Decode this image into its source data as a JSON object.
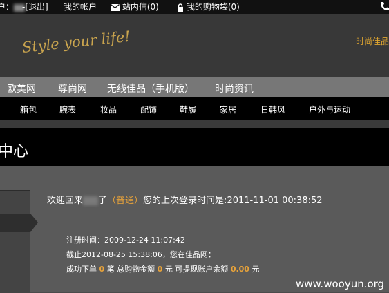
{
  "topbar": {
    "user_fragment": "户：",
    "logout": "-[退出]",
    "account": "我的帐户",
    "messages": "站内信(0)",
    "cart": "我的购物袋(0)"
  },
  "header": {
    "slogan": "Style your life!",
    "right_link": "时尚佳品"
  },
  "main_nav": [
    "欧美网",
    "尊尚网",
    "无线佳品（手机版）",
    "时尚资讯"
  ],
  "category_nav": [
    "箱包",
    "腕表",
    "妆品",
    "配饰",
    "鞋履",
    "家居",
    "日韩风",
    "户外与运动"
  ],
  "page_title": "中心",
  "welcome": {
    "prefix": "欢迎回来",
    "name_suffix": "子",
    "level": "（普通）",
    "last_login_label": "您的上次登录时间是:",
    "last_login_time": "2011-11-01 00:38:52"
  },
  "info": {
    "register_label": "注册时间：",
    "register_time": "2009-12-24 11:07:42",
    "cutoff_prefix": "截止",
    "cutoff_time": "2012-08-25 15:38:06",
    "cutoff_suffix": "，您在佳品网：",
    "orders_label": "成功下单",
    "orders_count": "0",
    "orders_unit": "笔",
    "total_label": "总购物金额",
    "total_amount": "0",
    "total_unit": "元",
    "balance_label": "可提现账户余额",
    "balance_amount": "0.00",
    "balance_unit": "元"
  },
  "watermark": "www.wooyun.org",
  "colors": {
    "accent": "#e8a33a",
    "topbar_bg": "#111111",
    "nav_bg": "#777777",
    "category_bg": "#000000"
  },
  "icons": [
    "mail-icon",
    "lock-icon",
    "phone-icon"
  ]
}
